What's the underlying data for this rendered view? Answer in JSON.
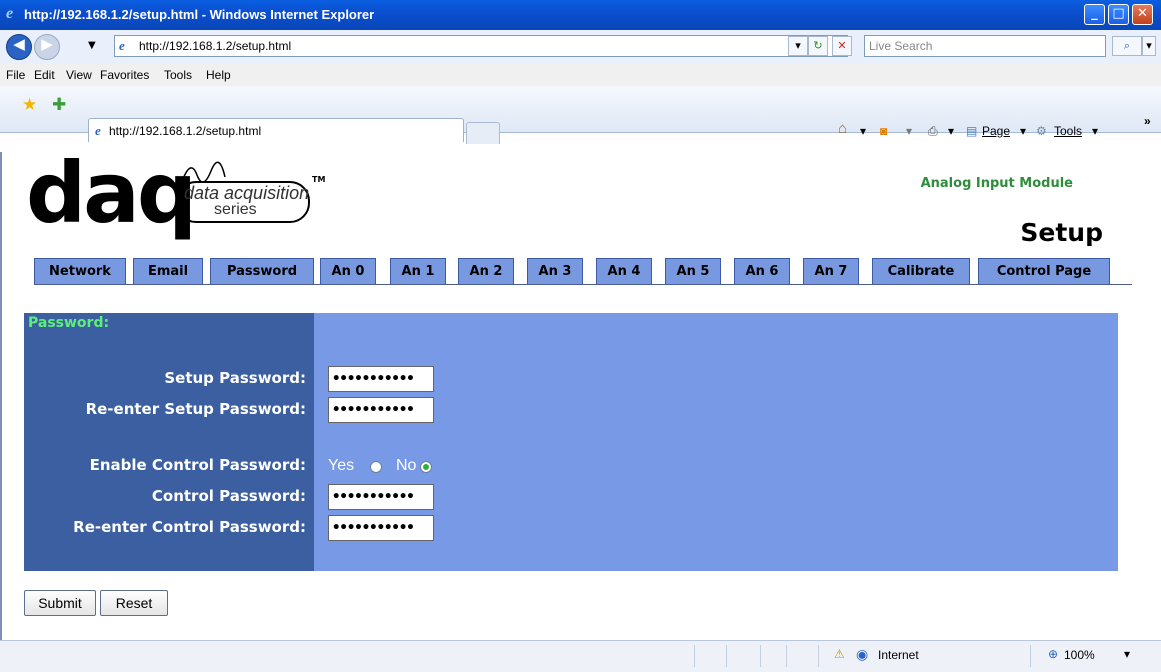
{
  "window": {
    "title": "http://192.168.1.2/setup.html - Windows Internet Explorer",
    "controls": [
      "_",
      "□",
      "X"
    ]
  },
  "address_bar": {
    "url": "http://192.168.1.2/setup.html",
    "search_placeholder": "Live Search"
  },
  "menu": {
    "items": [
      "File",
      "Edit",
      "View",
      "Favorites",
      "Tools",
      "Help"
    ]
  },
  "tabs": {
    "active_label": "http://192.168.1.2/setup.html"
  },
  "command_bar": {
    "page_label": "Page",
    "tools_label": "Tools"
  },
  "header": {
    "logo_main": "daq",
    "logo_line1": "data acquisition",
    "logo_line2": "series",
    "logo_tm": "TM",
    "module_name": "Analog Input Module",
    "page_title": "Setup"
  },
  "nav_tabs": [
    "Network",
    "Email",
    "Password",
    "An 0",
    "An 1",
    "An 2",
    "An 3",
    "An 4",
    "An 5",
    "An 6",
    "An 7",
    "Calibrate",
    "Control Page"
  ],
  "form": {
    "section_title": "Password:",
    "setup_password_label": "Setup Password:",
    "setup_password_value": "•••••••••••",
    "reenter_setup_label": "Re-enter Setup Password:",
    "reenter_setup_value": "•••••••••••",
    "enable_control_label": "Enable Control Password:",
    "yes_label": "Yes",
    "no_label": "No",
    "enable_control_selected": "No",
    "control_password_label": "Control Password:",
    "control_password_value": "•••••••••••",
    "reenter_control_label": "Re-enter Control Password:",
    "reenter_control_value": "•••••••••••",
    "submit_label": "Submit",
    "reset_label": "Reset"
  },
  "status_bar": {
    "zone": "Internet",
    "zoom": "100%"
  },
  "colors": {
    "panel_left": "#3c5fa1",
    "panel_right": "#7899e6",
    "tab_bg": "#7899e0",
    "section_title": "#5cf07a",
    "module_name": "#2f8e3c"
  }
}
